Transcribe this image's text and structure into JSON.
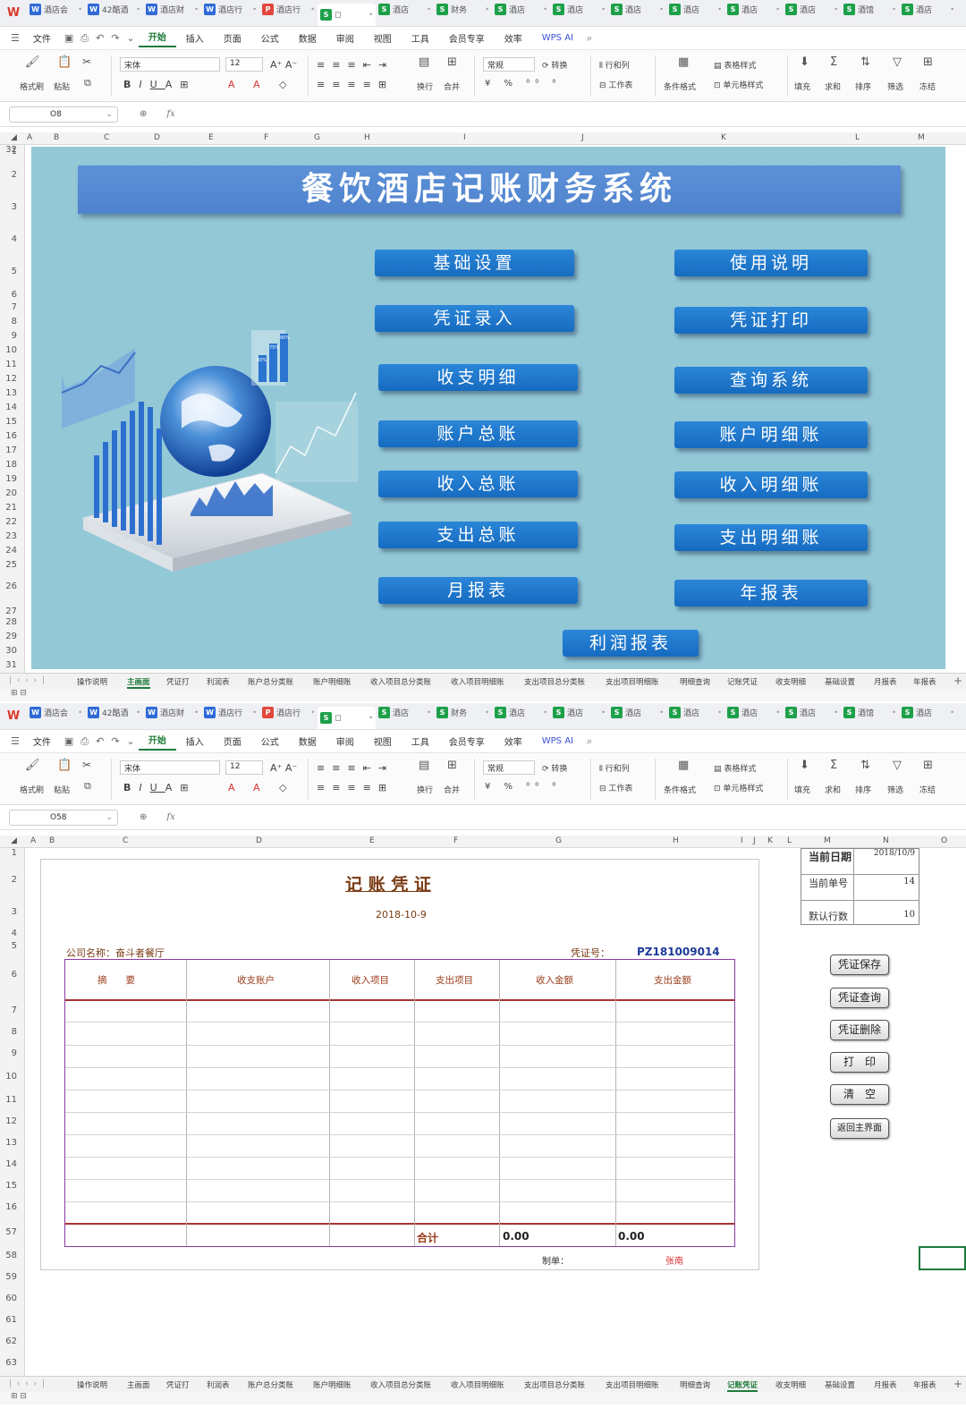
{
  "doc_tabs": [
    {
      "type": "w",
      "label": "酒店会"
    },
    {
      "type": "w",
      "label": "42酷酒"
    },
    {
      "type": "w",
      "label": "酒店财"
    },
    {
      "type": "w",
      "label": "酒店行"
    },
    {
      "type": "p",
      "label": "酒店行"
    },
    {
      "type": "s",
      "label": "◻",
      "active": true
    },
    {
      "type": "s",
      "label": "酒店"
    },
    {
      "type": "s",
      "label": "财务"
    },
    {
      "type": "s",
      "label": "酒店"
    },
    {
      "type": "s",
      "label": "酒店"
    },
    {
      "type": "s",
      "label": "酒店"
    },
    {
      "type": "s",
      "label": "酒店"
    },
    {
      "type": "s",
      "label": "酒店"
    },
    {
      "type": "s",
      "label": "酒店"
    },
    {
      "type": "s",
      "label": "酒馆"
    },
    {
      "type": "s",
      "label": "酒店"
    }
  ],
  "menu": [
    "文件",
    "开始",
    "插入",
    "页面",
    "公式",
    "数据",
    "审阅",
    "视图",
    "工具",
    "会员专享",
    "效率",
    "WPS AI"
  ],
  "ribbon": {
    "format_painter": "格式刷",
    "paste": "粘贴",
    "font": "宋体",
    "size": "12",
    "wrap": "换行",
    "merge": "合并",
    "number_format": "常规",
    "convert": "转换",
    "row_col": "行和列",
    "worksheet": "工作表",
    "cond_format": "条件格式",
    "table_style": "表格样式",
    "cell_style": "单元格样式",
    "fill": "填充",
    "sum": "求和",
    "sort": "排序",
    "filter": "筛选",
    "freeze": "冻结"
  },
  "window1": {
    "cell_ref": "O8",
    "columns": [
      "A",
      "B",
      "C",
      "D",
      "E",
      "F",
      "G",
      "H",
      "I",
      "J",
      "K",
      "L",
      "M"
    ],
    "rows": [
      "1",
      "2",
      "3",
      "4",
      "5",
      "6",
      "7",
      "8",
      "9",
      "10",
      "11",
      "12",
      "13",
      "14",
      "15",
      "16",
      "17",
      "18",
      "19",
      "20",
      "21",
      "22",
      "23",
      "24",
      "25",
      "26",
      "27",
      "28",
      "29",
      "30",
      "31",
      "32"
    ],
    "title": "餐饮酒店记账财务系统",
    "buttons": [
      "基础设置",
      "使用说明",
      "凭证录入",
      "凭证打印",
      "收支明细",
      "查询系统",
      "账户总账",
      "账户明细账",
      "收入总账",
      "收入明细账",
      "支出总账",
      "支出明细账",
      "月报表",
      "年报表",
      "利润报表"
    ],
    "chart_labels": [
      "60%",
      "75%",
      "90%"
    ]
  },
  "sheets": [
    "操作说明",
    "主画面",
    "凭证打",
    "利润表",
    "账户总分类账",
    "账户明细账",
    "收入项目总分类账",
    "收入项目明细账",
    "支出项目总分类账",
    "支出项目明细账",
    "明细查询",
    "记账凭证",
    "收支明细",
    "基础设置",
    "月报表",
    "年报表"
  ],
  "window2": {
    "cell_ref": "O58",
    "columns": [
      "A",
      "B",
      "C",
      "D",
      "E",
      "F",
      "G",
      "H",
      "I",
      "J",
      "K",
      "L",
      "M",
      "N",
      "O"
    ],
    "rows": [
      "1",
      "2",
      "3",
      "4",
      "5",
      "6",
      "7",
      "8",
      "9",
      "10",
      "11",
      "12",
      "13",
      "14",
      "15",
      "16",
      "57",
      "58",
      "59",
      "60",
      "61",
      "62",
      "63"
    ],
    "voucher": {
      "title": "记 账 凭 证",
      "date": "2018-10-9",
      "company_label": "公司名称：奋斗者餐厅",
      "number_label": "凭证号：",
      "number": "PZ181009014",
      "headers": [
        "摘　　要",
        "收支账户",
        "收入项目",
        "支出项目",
        "收入金额",
        "支出金额"
      ],
      "total_label": "合计",
      "income_total": "0.00",
      "expense_total": "0.00",
      "maker_label": "制单：",
      "maker": "张南"
    },
    "info": [
      {
        "label": "当前日期",
        "value": "2018/10/9"
      },
      {
        "label": "当前单号",
        "value": "14"
      },
      {
        "label": "默认行数",
        "value": "10"
      }
    ],
    "buttons": [
      "凭证保存",
      "凭证查询",
      "凭证删除",
      "打　印",
      "清　空",
      "返回主界面"
    ]
  }
}
